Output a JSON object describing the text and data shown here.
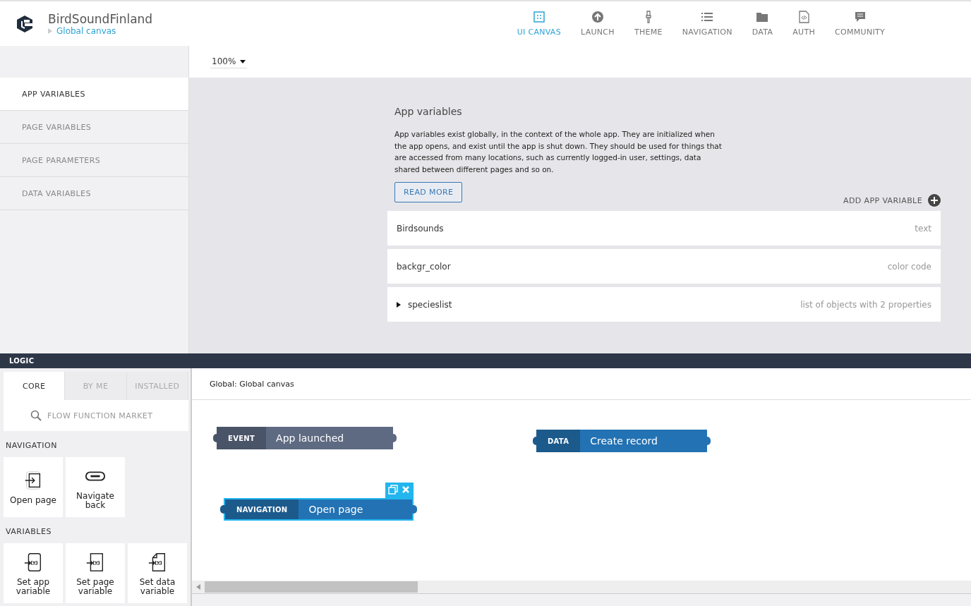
{
  "app": {
    "name": "BirdSoundFinland",
    "breadcrumb": "Global canvas"
  },
  "nav_tabs": [
    {
      "label": "UI CANVAS",
      "selected": true
    },
    {
      "label": "LAUNCH",
      "selected": false
    },
    {
      "label": "THEME",
      "selected": false
    },
    {
      "label": "NAVIGATION",
      "selected": false
    },
    {
      "label": "DATA",
      "selected": false
    },
    {
      "label": "AUTH",
      "selected": false
    },
    {
      "label": "COMMUNITY",
      "selected": false
    }
  ],
  "zoom": {
    "value": "100%"
  },
  "sidebar": {
    "items": [
      {
        "label": "APP VARIABLES",
        "selected": true
      },
      {
        "label": "PAGE VARIABLES",
        "selected": false
      },
      {
        "label": "PAGE PARAMETERS",
        "selected": false
      },
      {
        "label": "DATA VARIABLES",
        "selected": false
      }
    ]
  },
  "app_variables": {
    "title": "App variables",
    "description": "App variables exist globally, in the context of the whole app. They are initialized when the app opens, and exist until the app is shut down. They should be used for things that are accessed from many locations, such as currently logged-in user, settings, data shared between different pages and so on.",
    "read_more": "READ MORE",
    "add_label": "ADD APP VARIABLE",
    "variables": [
      {
        "name": "Birdsounds",
        "type": "text",
        "kind": "plain"
      },
      {
        "name": "backgr_color",
        "type": "color code",
        "kind": "plain"
      },
      {
        "name": "specieslist",
        "type": "list of objects with 2 properties",
        "kind": "expandable"
      }
    ]
  },
  "logic": {
    "title": "LOGIC",
    "tabs": [
      {
        "label": "CORE",
        "selected": true
      },
      {
        "label": "BY ME",
        "selected": false
      },
      {
        "label": "INSTALLED",
        "selected": false
      }
    ],
    "search": {
      "placeholder": "FLOW FUNCTION MARKET"
    },
    "groups": [
      {
        "title": "NAVIGATION",
        "items": [
          {
            "label": "Open page"
          },
          {
            "label": "Navigate back"
          }
        ]
      },
      {
        "title": "VARIABLES",
        "items": [
          {
            "label": "Set app variable"
          },
          {
            "label": "Set page variable"
          },
          {
            "label": "Set data variable"
          }
        ]
      }
    ],
    "canvas_title": "Global: Global canvas",
    "nodes": [
      {
        "kind": "event",
        "tag": "EVENT",
        "label": "App launched",
        "selected": false
      },
      {
        "kind": "data",
        "tag": "DATA",
        "label": "Create record",
        "selected": false
      },
      {
        "kind": "navigation",
        "tag": "NAVIGATION",
        "label": "Open page",
        "selected": true
      }
    ]
  }
}
